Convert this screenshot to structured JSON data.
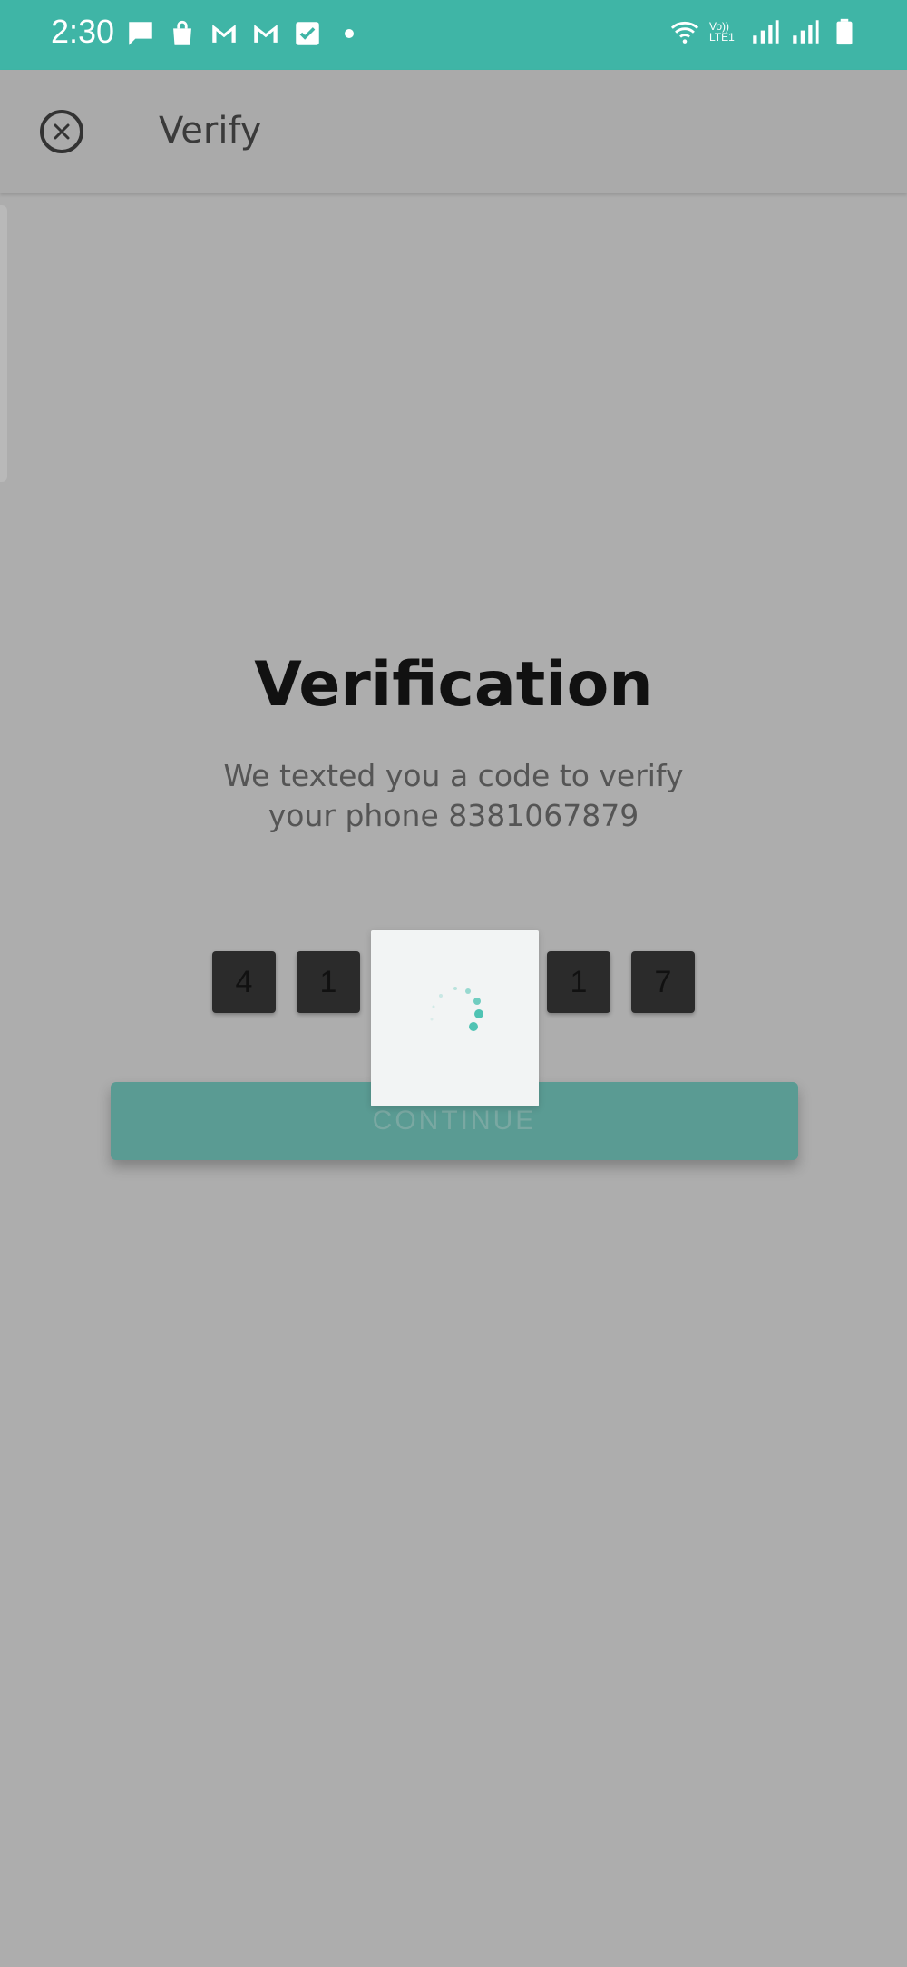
{
  "status_bar": {
    "time": "2:30",
    "left_icons": [
      "chat-icon",
      "shopping-bag-icon",
      "gmail-icon",
      "gmail-icon",
      "checkbox-icon"
    ],
    "right_icons": [
      "wifi-icon",
      "volte-icon",
      "signal-icon",
      "signal-icon",
      "battery-icon"
    ],
    "volte_label": "Vo)) LTE1"
  },
  "app_bar": {
    "title": "Verify",
    "close_icon": "close-circle-icon"
  },
  "main": {
    "heading": "Verification",
    "subtitle_line1": "We texted you a code to verify",
    "subtitle_line2": "your phone 8381067879",
    "code_digits": [
      "4",
      "1",
      "",
      "",
      "1",
      "7"
    ],
    "continue_label": "CONTINUE"
  },
  "loader": {
    "icon": "spinner-icon"
  },
  "colors": {
    "status_bar": "#3fb5a6",
    "overlay_background": "#adadad",
    "accent": "#5a9b93",
    "spinner": "#4fc3b3"
  }
}
